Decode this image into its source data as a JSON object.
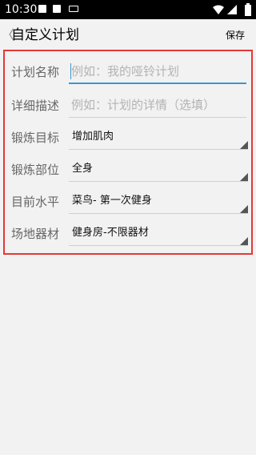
{
  "status_bar": {
    "time": "10:30",
    "icons": [
      "notification-icon",
      "notification-icon",
      "keyboard-icon",
      "wifi-icon",
      "signal-icon",
      "battery-icon"
    ]
  },
  "header": {
    "back_glyph": "〈",
    "title": "自定义计划",
    "save_label": "保存"
  },
  "form": {
    "plan_name": {
      "label": "计划名称",
      "value": "",
      "placeholder": "例如：我的哑铃计划"
    },
    "plan_description": {
      "label": "详细描述",
      "value": "",
      "placeholder": "例如：计划的详情（选填）"
    },
    "goal": {
      "label": "锻炼目标",
      "selected": "增加肌肉"
    },
    "body_part": {
      "label": "锻炼部位",
      "selected": "全身"
    },
    "level": {
      "label": "目前水平",
      "selected": "菜鸟- 第一次健身"
    },
    "equipment": {
      "label": "场地器材",
      "selected": "健身房-不限器材"
    }
  },
  "colors": {
    "accent": "#3a97cc",
    "highlight_border": "#e53935",
    "background": "#f2f2f2"
  }
}
